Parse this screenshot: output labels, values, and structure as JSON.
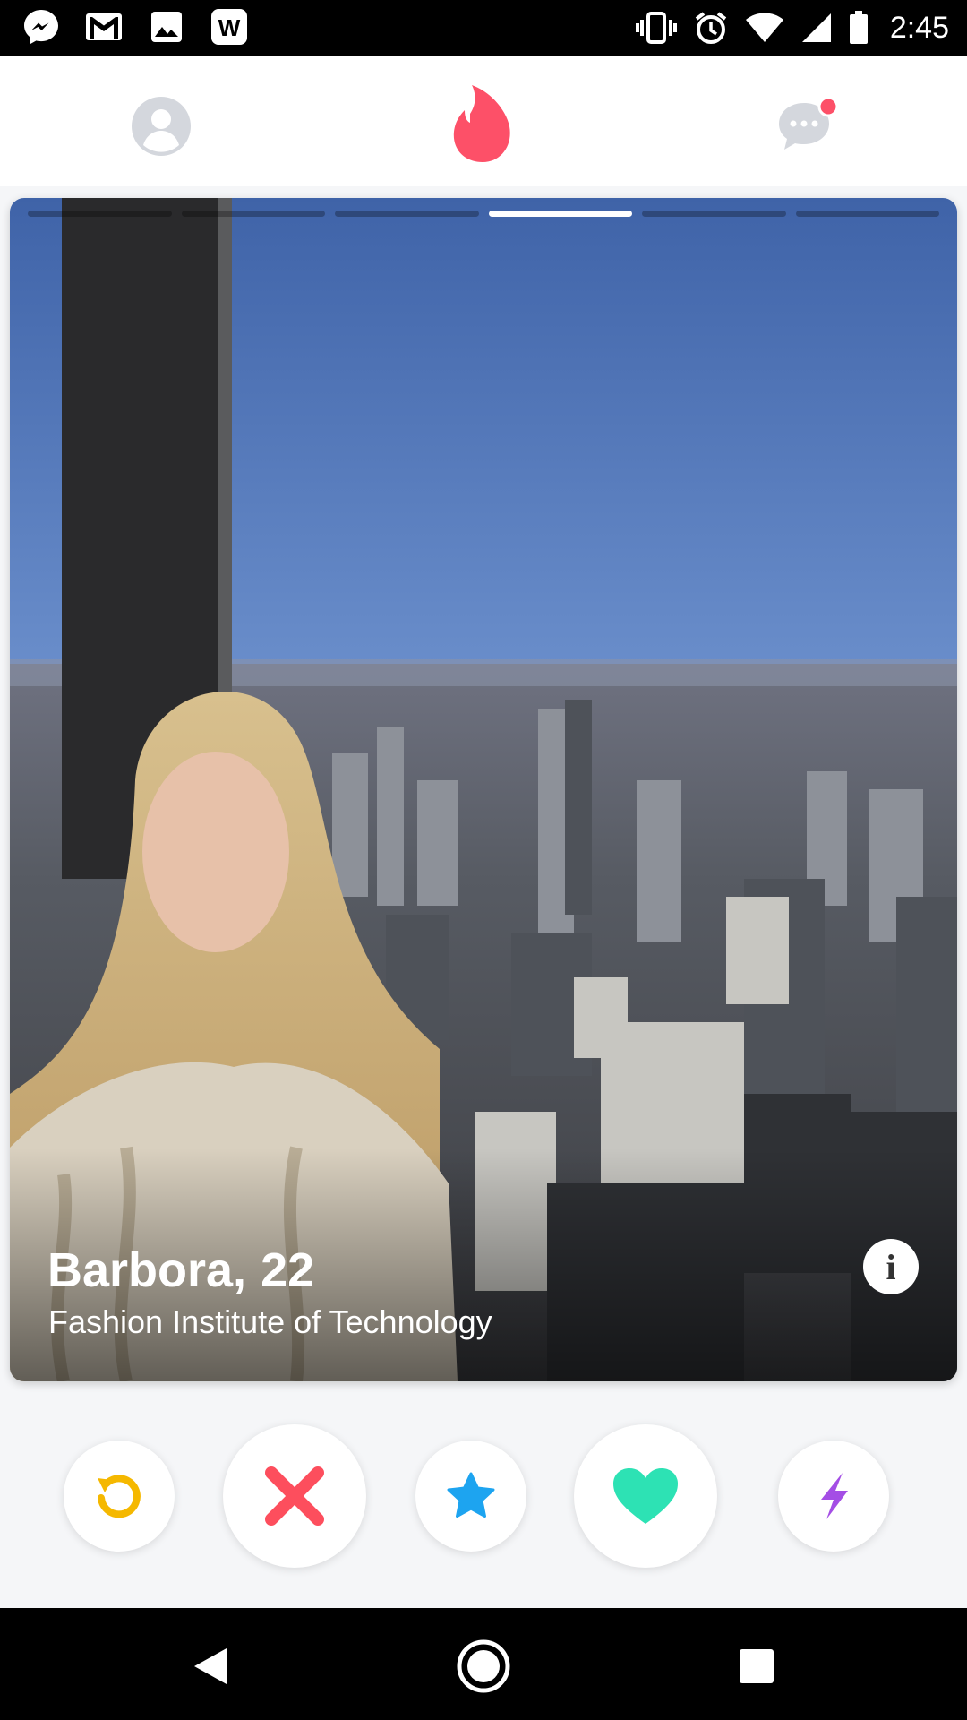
{
  "status_bar": {
    "time": "2:45",
    "left_icons": [
      "messenger-icon",
      "gmail-icon",
      "gallery-icon",
      "w-app-icon"
    ],
    "w_letter": "W",
    "right_icons": [
      "vibrate-icon",
      "alarm-icon",
      "wifi-icon",
      "cell-signal-icon",
      "battery-icon"
    ]
  },
  "top_nav": {
    "icons": [
      "profile-icon",
      "tinder-flame-icon",
      "messages-icon"
    ],
    "messages_badge": true
  },
  "card": {
    "photo_count": 6,
    "active_photo_index": 3,
    "name": "Barbora,",
    "age": "22",
    "school": "Fashion Institute of Technology",
    "info_label": "i"
  },
  "actions": [
    "rewind-icon",
    "nope-x-icon",
    "super-like-star-icon",
    "like-heart-icon",
    "boost-bolt-icon"
  ],
  "colors": {
    "brand": "#fd5068",
    "rewind": "#f5b800",
    "nope": "#fd4e5d",
    "super_like": "#1da4f0",
    "like": "#2de2b4",
    "boost": "#a44ee5"
  },
  "nav_bar": [
    "back-icon",
    "home-icon",
    "recents-icon"
  ]
}
